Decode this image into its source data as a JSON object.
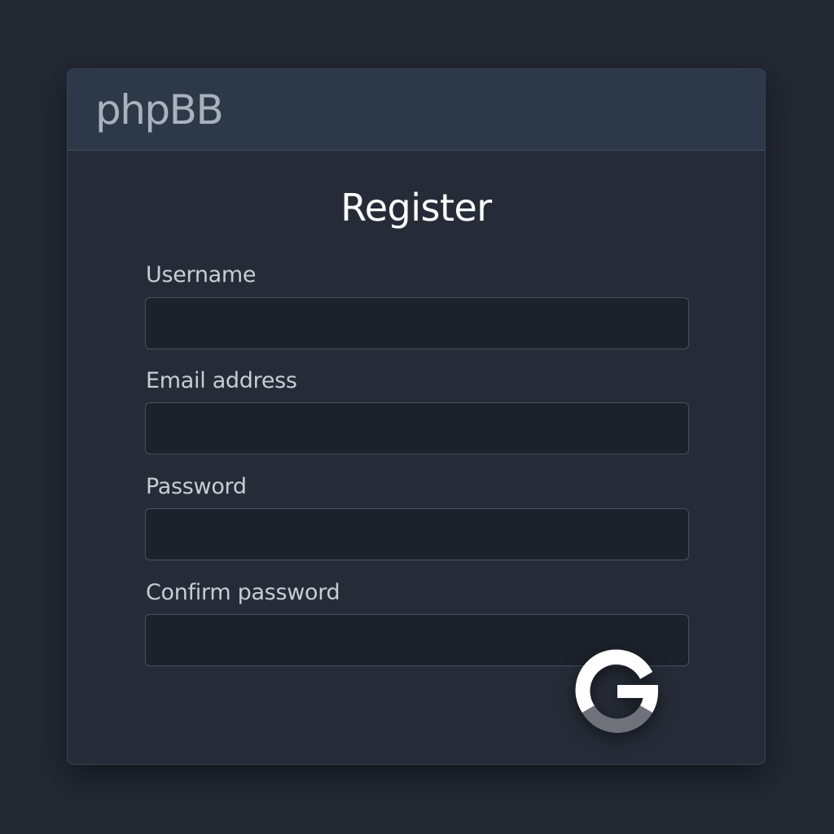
{
  "header": {
    "logo_text": "phpBB"
  },
  "form": {
    "title": "Register",
    "fields": [
      {
        "label": "Username",
        "value": ""
      },
      {
        "label": "Email address",
        "value": ""
      },
      {
        "label": "Password",
        "value": ""
      },
      {
        "label": "Confirm password",
        "value": ""
      }
    ]
  },
  "icons": {
    "overlay_icon": "google-g-icon"
  },
  "colors": {
    "background": "#232833",
    "card": "#262c37",
    "header": "#2d3848",
    "input": "#1d212b",
    "logo": "#a9b1bc",
    "icon_primary": "#ffffff",
    "icon_secondary": "#6f7278"
  }
}
